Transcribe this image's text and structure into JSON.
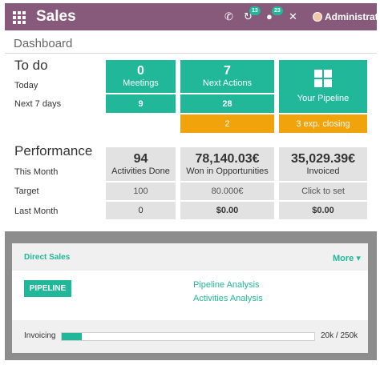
{
  "topbar": {
    "title": "Sales",
    "user": "Administrator",
    "chat_badge": "13",
    "messages_badge": "23",
    "icons": [
      "apps-grid-icon",
      "phone-icon",
      "activity-icon",
      "chat-icon",
      "tools-icon",
      "avatar"
    ]
  },
  "breadcrumb": "Dashboard",
  "todo": {
    "title": "To do",
    "rows": [
      "Today",
      "Next 7 days"
    ],
    "meetings": {
      "count": "0",
      "label": "Meetings",
      "next7": "9"
    },
    "next_actions": {
      "count": "7",
      "label": "Next Actions",
      "next7": "28",
      "overdue": "2"
    },
    "pipeline": {
      "label": "Your Pipeline",
      "closing": "3 exp. closing"
    }
  },
  "performance": {
    "title": "Performance",
    "rows": [
      "This Month",
      "Target",
      "Last Month"
    ],
    "activities": {
      "value": "94",
      "label": "Activities Done",
      "target": "100",
      "last": "0"
    },
    "won": {
      "value": "78,140.03€",
      "label": "Won in Opportunities",
      "target": "80.000€",
      "last": "$0.00"
    },
    "invoiced": {
      "value": "35,029.39€",
      "label": "Invoiced",
      "target": "Click to set",
      "last": "$0.00"
    }
  },
  "team": {
    "title": "Direct Sales",
    "more": "More ▾",
    "pipeline_button": "PIPELINE",
    "links": [
      "Pipeline Analysis",
      "Activities Analysis"
    ],
    "invoicing_label": "Invoicing",
    "invoicing_value": "20k / 250k",
    "invoicing_fraction": 0.08
  },
  "colors": {
    "brand": "#875a7b",
    "accent": "#21b799",
    "warning": "#f0a30a",
    "neutral": "#e2e2e2"
  }
}
